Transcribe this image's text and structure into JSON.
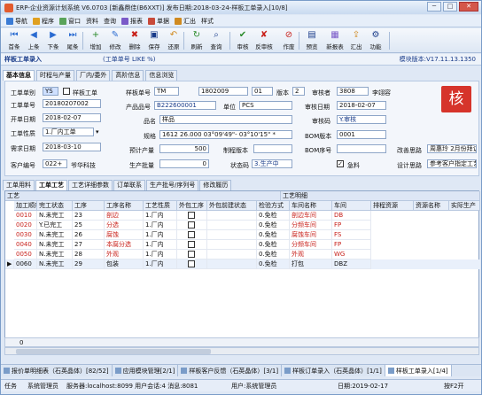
{
  "window": {
    "title": "ERP-企业资源计划系统 V6.0703 [新鑫鼎佳(B6XXT)] 发布日期:2018-03-24-样板工单录入[10/8]",
    "min": "─",
    "max": "□",
    "close": "✕"
  },
  "menu": [
    "导航",
    "程序",
    "窗口",
    "资料",
    "查询",
    "报表",
    "单据",
    "汇出",
    "样式"
  ],
  "toolbar": [
    {
      "label": "首条",
      "icon": "first-icon",
      "glyph": "⏮"
    },
    {
      "label": "上条",
      "icon": "prev-icon",
      "glyph": "◀"
    },
    {
      "label": "下条",
      "icon": "next-icon",
      "glyph": "▶"
    },
    {
      "label": "尾条",
      "icon": "last-icon",
      "glyph": "⏭"
    },
    {
      "label": "增加",
      "icon": "add-icon",
      "glyph": "+"
    },
    {
      "label": "修改",
      "icon": "edit-icon",
      "glyph": "✎"
    },
    {
      "label": "删除",
      "icon": "delete-icon",
      "glyph": "✖"
    },
    {
      "label": "保存",
      "icon": "save-icon",
      "glyph": "▣"
    },
    {
      "label": "还原",
      "icon": "undo-icon",
      "glyph": "↶"
    },
    {
      "label": "刷新",
      "icon": "refresh-icon",
      "glyph": "↻"
    },
    {
      "label": "查询",
      "icon": "query-icon",
      "glyph": "⌕"
    },
    {
      "label": "审核",
      "icon": "approve-icon",
      "glyph": "✔"
    },
    {
      "label": "反审核",
      "icon": "unapprove-icon",
      "glyph": "✘"
    },
    {
      "label": "作废",
      "icon": "void-icon",
      "glyph": "⊘"
    },
    {
      "label": "预览",
      "icon": "preview-icon",
      "glyph": "▤"
    },
    {
      "label": "新报表",
      "icon": "report-icon",
      "glyph": "▦"
    },
    {
      "label": "汇出",
      "icon": "export-icon",
      "glyph": "⇪"
    },
    {
      "label": "功能",
      "icon": "function-icon",
      "glyph": "⚙"
    }
  ],
  "doc": {
    "tab": "样板工单录入",
    "filter": "(工单单号 LIKE %)",
    "version": "模块版本:V17.11.13.1350"
  },
  "form_tabs": [
    "基本信息",
    "时程与产量",
    "厂内/委外",
    "高阶信息",
    "信息浏览"
  ],
  "form": {
    "工单单别_label": "工单单别",
    "工单单别": "YS",
    "样板工单": "样板工单",
    "工单单号_label": "工单单号",
    "工单单号": "20180207002",
    "开单日期_label": "开单日期",
    "开单日期": "2018-02-07",
    "工单性质_label": "工单性质",
    "工单性质": "1.厂内工单",
    "需求日期_label": "需求日期",
    "需求日期": "2018-03-10",
    "客户编号_label": "客户编号",
    "客户编号": "022+",
    "客户名称": "爷华科技",
    "样板单号_label": "样板单号",
    "样板单号1": "TM",
    "样板单号2": "1802009",
    "样板单号3": "01",
    "版本_label": "版本",
    "版本": "2",
    "产品品号_label": "产品品号",
    "产品品号": "B222600001",
    "单位_label": "单位",
    "单位": "PCS",
    "品名_label": "品名",
    "品名": "样品",
    "规格_label": "规格",
    "规格": "1612 26.000 03°09'49\"- 03°10'15\" *",
    "预计产量_label": "预计产量",
    "预计产量": "500",
    "生产批量_label": "生产批量",
    "生产批量": "0",
    "制程版本_label": "制程版本",
    "状态码_label": "状态码",
    "状态码": "3.生产中",
    "审核者_label": "审核者",
    "审核者": "3808",
    "审核者名": "李翊容",
    "审核日期_label": "审核日期",
    "审核日期": "2018-02-07",
    "审核码_label": "审核码",
    "审核码": "Y.审核",
    "BOM版本_label": "BOM版本",
    "BOM版本": "0001",
    "BOM序号_label": "BOM序号",
    "急料_label": "急料",
    "改善思路_label": "改善思路",
    "改善思路": "周惠玲 2月份拜访",
    "设计思路_label": "设计思路",
    "设计思路": "参考客户指定工艺",
    "stamp": "核"
  },
  "lower_tabs": [
    "工单用料",
    "工单工艺",
    "工艺详细参数",
    "订单联系",
    "生产批号/序列号",
    "修改履历"
  ],
  "grid": {
    "group1": "工艺",
    "group2": "工艺明细",
    "headers": [
      "加工顺序",
      "完工状态",
      "工序",
      "工序名称",
      "工艺性质",
      "外包工序",
      "外包前建状态",
      "检验方式",
      "车间名称",
      "车间",
      "排程资源",
      "资源名称",
      "实际生产"
    ],
    "rows": [
      {
        "seq": "0010",
        "status": "N.未完工",
        "op": "23",
        "name": "剖边",
        "nature": "1.厂内",
        "out": "",
        "outstat": "",
        "insp": "0.免检",
        "ws_name": "剖边车间",
        "ws": "DB",
        "red": true
      },
      {
        "seq": "0020",
        "status": "Y.已完工",
        "op": "25",
        "name": "分选",
        "nature": "1.厂内",
        "out": "",
        "outstat": "",
        "insp": "0.免检",
        "ws_name": "分频车间",
        "ws": "FP",
        "red": true
      },
      {
        "seq": "0030",
        "status": "N.未完工",
        "op": "26",
        "name": "腐蚀",
        "nature": "1.厂内",
        "out": "",
        "outstat": "",
        "insp": "0.免检",
        "ws_name": "腐蚀车间",
        "ws": "FS",
        "red": true
      },
      {
        "seq": "0040",
        "status": "N.未完工",
        "op": "27",
        "name": "本腐分选",
        "nature": "1.厂内",
        "out": "",
        "outstat": "",
        "insp": "0.免检",
        "ws_name": "分频车间",
        "ws": "FP",
        "red": true
      },
      {
        "seq": "0050",
        "status": "N.未完工",
        "op": "28",
        "name": "外观",
        "nature": "1.厂内",
        "out": "",
        "outstat": "",
        "insp": "0.免检",
        "ws_name": "外观",
        "ws": "WG",
        "red": true
      },
      {
        "seq": "0060",
        "status": "N.未完工",
        "op": "29",
        "name": "包装",
        "nature": "1.厂内",
        "out": "",
        "outstat": "",
        "insp": "0.免检",
        "ws_name": "打包",
        "ws": "DBZ",
        "red": false
      }
    ],
    "footer": "0"
  },
  "taskbar": [
    "报价单明细表（石英晶体）[82/52]",
    "应用模块管理[2/1]",
    "样板客户反馈（石英晶体）[3/1]",
    "样板订单录入（石英晶体）[1/1]",
    "样板工单录入[1/4]"
  ],
  "status": {
    "tasks": "任务",
    "user": "系统管理员",
    "server": "服务器:localhost:8099 用户会话:4 消息:8081",
    "role": "用户:系统管理员",
    "date": "日期:2019-02-17",
    "hint": "按F2开"
  }
}
